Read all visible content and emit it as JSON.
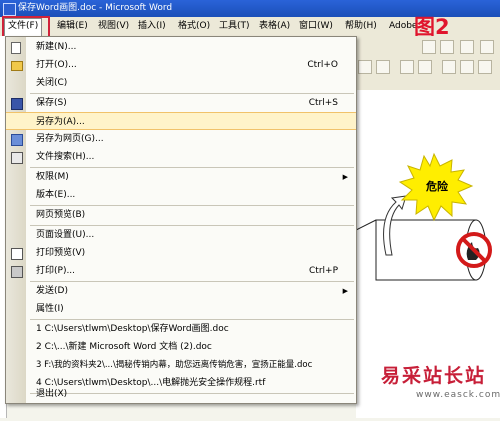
{
  "titlebar": {
    "title": "保存Word画图.doc - Microsoft Word"
  },
  "menubar": {
    "items": [
      "文件(F)",
      "编辑(E)",
      "视图(V)",
      "插入(I)",
      "格式(O)",
      "工具(T)",
      "表格(A)",
      "窗口(W)",
      "帮助(H)",
      "Adobe"
    ]
  },
  "annotation": {
    "badge": "图2"
  },
  "file_menu": {
    "new": "新建(N)...",
    "open": "打开(O)...",
    "open_shortcut": "Ctrl+O",
    "close": "关闭(C)",
    "save": "保存(S)",
    "save_shortcut": "Ctrl+S",
    "save_as": "另存为(A)...",
    "save_as_web": "另存为网页(G)...",
    "file_search": "文件搜索(H)...",
    "permission": "权限(M)",
    "versions": "版本(E)...",
    "web_preview": "网页预览(B)",
    "page_setup": "页面设置(U)...",
    "print_preview": "打印预览(V)",
    "print": "打印(P)...",
    "print_shortcut": "Ctrl+P",
    "send_to": "发送(D)",
    "properties": "属性(I)",
    "recent1": "1 C:\\Users\\tlwm\\Desktop\\保存Word画图.doc",
    "recent2": "2 C:\\...\\新建 Microsoft Word 文档 (2).doc",
    "recent3": "3 F:\\我的资料夹2\\...\\揭秘传销内幕，助您远离传销危害，宣扬正能量.doc",
    "recent4": "4 C:\\Users\\tlwm\\Desktop\\...\\电解抛光安全操作规程.rtf",
    "exit": "退出(X)"
  },
  "document": {
    "danger_label": "危险"
  },
  "watermark": {
    "line1": "易采站长站",
    "line2": "www.easck.com"
  },
  "colors": {
    "annotation_red": "#d0223a",
    "highlight": "#fff3c9",
    "burst_yellow": "#ffee00"
  }
}
